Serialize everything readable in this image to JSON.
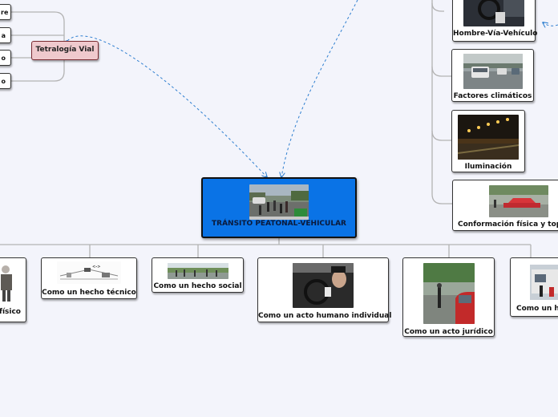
{
  "central": {
    "title": "TRÁNSITO PEATONAL-VEHICULAR"
  },
  "tetralogia": {
    "label": "Tetralogía Vial"
  },
  "left_items": [
    {
      "label": "re"
    },
    {
      "label": "a"
    },
    {
      "label": "o"
    },
    {
      "label": "o"
    }
  ],
  "right_items": [
    {
      "label": "Hombre-Vía-Vehículo"
    },
    {
      "label": "Factores climáticos"
    },
    {
      "label": "Iluminación"
    },
    {
      "label": "Conformación física y topog"
    }
  ],
  "bottom_items": [
    {
      "label": "físico"
    },
    {
      "label": "Como un hecho técnico"
    },
    {
      "label": "Como un hecho social"
    },
    {
      "label": "Como un acto humano individual"
    },
    {
      "label": "Como un acto jurídico"
    },
    {
      "label": "Como un he"
    }
  ],
  "colors": {
    "background": "#f3f4fb",
    "central_fill": "#0a73e6",
    "tetralogia_fill": "#efc9cd",
    "connector": "#b3b3b3",
    "dashed_link": "#2f7fd0"
  }
}
